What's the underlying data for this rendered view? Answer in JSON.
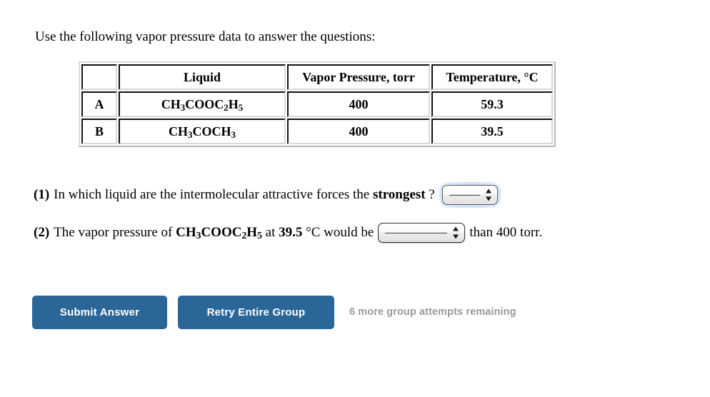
{
  "prompt": "Use the following vapor pressure data to answer the questions:",
  "table": {
    "headers": [
      "",
      "Liquid",
      "Vapor Pressure, torr",
      "Temperature, °C"
    ],
    "rows": [
      {
        "label": "A",
        "liquid_parts": [
          "CH",
          "3",
          "COOC",
          "2",
          "H",
          "5"
        ],
        "liquid_text": "CH3COOC2H5",
        "vapor_pressure": "400",
        "temperature": "59.3"
      },
      {
        "label": "B",
        "liquid_parts": [
          "CH",
          "3",
          "COCH",
          "3",
          "",
          ""
        ],
        "liquid_text": "CH3COCH3",
        "vapor_pressure": "400",
        "temperature": "39.5"
      }
    ]
  },
  "questions": [
    {
      "number": "(1)",
      "text_before": "In which liquid are the intermolecular attractive forces the ",
      "emphasis": "strongest",
      "text_after": " ?",
      "select": {
        "value": "———",
        "width": "narrow",
        "focused": true
      },
      "trailing": ""
    },
    {
      "number": "(2)",
      "text_before": "The vapor pressure of ",
      "formula_parts": [
        "CH",
        "3",
        "COOC",
        "2",
        "H",
        "5"
      ],
      "formula_text": "CH3COOC2H5",
      "text_mid": " at ",
      "temperature": "39.5",
      "units": " °C",
      "text_after": " would be",
      "select": {
        "value": "——————",
        "width": "wide",
        "focused": false
      },
      "trailing": "than 400 torr."
    }
  ],
  "actions": {
    "submit_label": "Submit Answer",
    "retry_label": "Retry Entire Group",
    "attempts_text": "6 more group attempts remaining",
    "button_color": "#2b6698",
    "attempts_color": "#9a9a9a"
  }
}
